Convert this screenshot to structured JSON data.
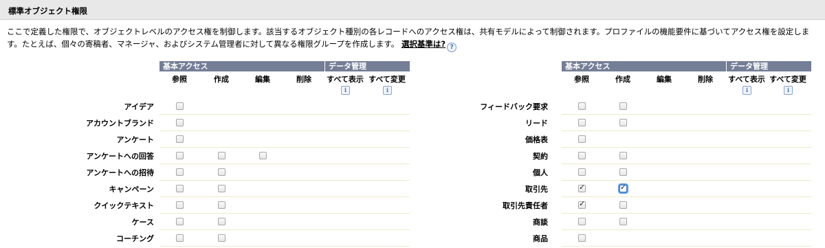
{
  "section": {
    "title": "標準オブジェクト権限"
  },
  "description": {
    "text": "ここで定義した権限で、オブジェクトレベルのアクセス権を制御します。該当するオブジェクト種別の各レコードへのアクセス権は、共有モデルによって制御されます。プロファイルの機能要件に基づいてアクセス権を設定します。たとえば、個々の寄稿者、マネージャ、およびシステム管理者に対して異なる権限グループを作成します。",
    "link_label": "選択基準は?",
    "help_icon": "question-mark-icon"
  },
  "table_headers": {
    "basic_access": "基本アクセス",
    "data_management": "データ管理",
    "columns": [
      "参照",
      "作成",
      "編集",
      "削除",
      "すべて表示",
      "すべて変更"
    ],
    "info_icon": "info-icon"
  },
  "left_table": {
    "rows": [
      {
        "label": "アイデア",
        "checkboxes": [
          {
            "visible": true,
            "checked": false
          }
        ]
      },
      {
        "label": "アカウントブランド",
        "checkboxes": [
          {
            "visible": true,
            "checked": false
          }
        ]
      },
      {
        "label": "アンケート",
        "checkboxes": [
          {
            "visible": true,
            "checked": false
          }
        ]
      },
      {
        "label": "アンケートへの回答",
        "checkboxes": [
          {
            "visible": true,
            "checked": false
          },
          {
            "visible": true,
            "checked": false
          },
          {
            "visible": true,
            "checked": false
          }
        ]
      },
      {
        "label": "アンケートへの招待",
        "checkboxes": [
          {
            "visible": true,
            "checked": false
          },
          {
            "visible": true,
            "checked": false
          }
        ]
      },
      {
        "label": "キャンペーン",
        "checkboxes": [
          {
            "visible": true,
            "checked": false
          },
          {
            "visible": true,
            "checked": false
          }
        ]
      },
      {
        "label": "クイックテキスト",
        "checkboxes": [
          {
            "visible": true,
            "checked": false
          },
          {
            "visible": true,
            "checked": false
          }
        ]
      },
      {
        "label": "ケース",
        "checkboxes": [
          {
            "visible": true,
            "checked": false
          },
          {
            "visible": true,
            "checked": false
          }
        ]
      },
      {
        "label": "コーチング",
        "checkboxes": [
          {
            "visible": true,
            "checked": false
          },
          {
            "visible": true,
            "checked": false
          }
        ]
      }
    ]
  },
  "right_table": {
    "rows": [
      {
        "label": "フィードバック要求",
        "checkboxes": [
          {
            "visible": true,
            "checked": false
          },
          {
            "visible": true,
            "checked": false
          }
        ]
      },
      {
        "label": "リード",
        "checkboxes": [
          {
            "visible": true,
            "checked": false
          },
          {
            "visible": true,
            "checked": false
          }
        ]
      },
      {
        "label": "価格表",
        "checkboxes": [
          {
            "visible": true,
            "checked": false
          }
        ]
      },
      {
        "label": "契約",
        "checkboxes": [
          {
            "visible": true,
            "checked": false
          },
          {
            "visible": true,
            "checked": false
          }
        ]
      },
      {
        "label": "個人",
        "checkboxes": [
          {
            "visible": true,
            "checked": false
          },
          {
            "visible": true,
            "checked": false
          }
        ]
      },
      {
        "label": "取引先",
        "checkboxes": [
          {
            "visible": true,
            "checked": true
          },
          {
            "visible": true,
            "checked": true,
            "focused": true
          }
        ]
      },
      {
        "label": "取引先責任者",
        "checkboxes": [
          {
            "visible": true,
            "checked": true
          },
          {
            "visible": true,
            "checked": false
          }
        ]
      },
      {
        "label": "商談",
        "checkboxes": [
          {
            "visible": true,
            "checked": false
          },
          {
            "visible": true,
            "checked": false
          }
        ]
      },
      {
        "label": "商品",
        "checkboxes": [
          {
            "visible": true,
            "checked": false
          }
        ]
      }
    ]
  },
  "colors": {
    "header_bar": "#747e96",
    "section_bg": "#e8e8e9",
    "row_rule": "#ecebc9"
  }
}
